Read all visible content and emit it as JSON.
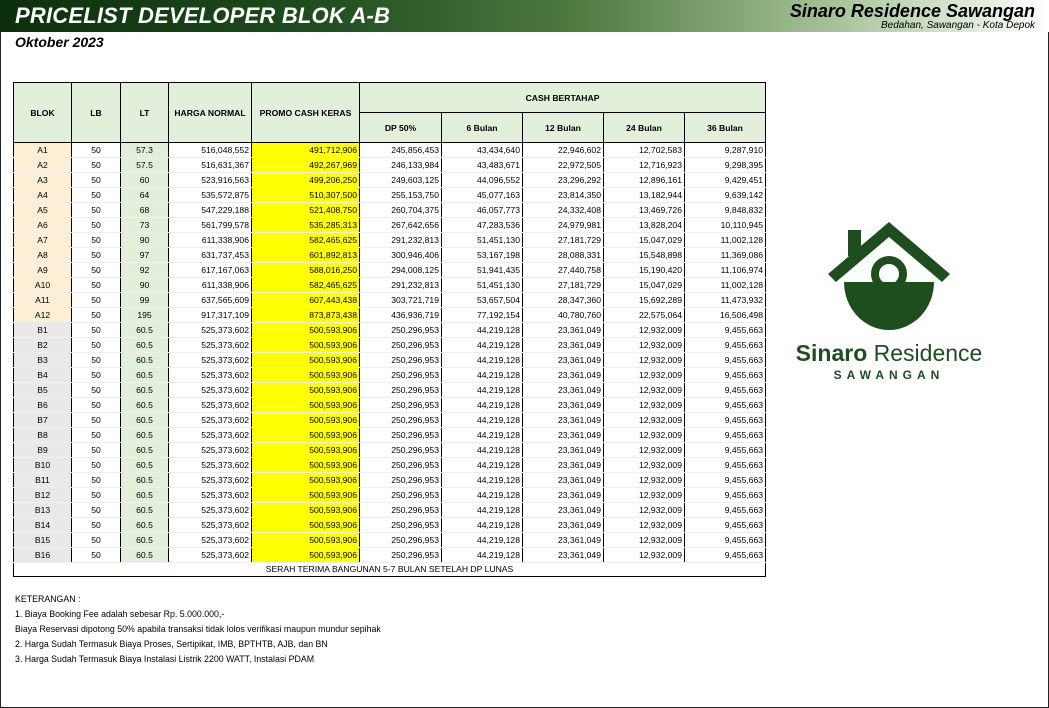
{
  "header": {
    "title": "PRICELIST DEVELOPER BLOK A-B",
    "period": "Oktober 2023",
    "brand": "Sinaro Residence Sawangan",
    "location": "Bedahan, Sawangan - Kota Depok"
  },
  "columns": {
    "blok": "BLOK",
    "lb": "LB",
    "lt": "LT",
    "harga_normal": "HARGA NORMAL",
    "promo": "PROMO CASH KERAS",
    "cash_bertahap": "CASH BERTAHAP",
    "dp": "DP 50%",
    "m6": "6 Bulan",
    "m12": "12 Bulan",
    "m24": "24 Bulan",
    "m36": "36 Bulan"
  },
  "rows": [
    [
      "A1",
      "50",
      "57.3",
      "516,048,552",
      "491,712,906",
      "245,856,453",
      "43,434,640",
      "22,946,602",
      "12,702,583",
      "9,287,910"
    ],
    [
      "A2",
      "50",
      "57.5",
      "516,631,367",
      "492,267,969",
      "246,133,984",
      "43,483,671",
      "22,972,505",
      "12,716,923",
      "9,298,395"
    ],
    [
      "A3",
      "50",
      "60",
      "523,916,563",
      "499,206,250",
      "249,603,125",
      "44,096,552",
      "23,296,292",
      "12,896,161",
      "9,429,451"
    ],
    [
      "A4",
      "50",
      "64",
      "535,572,875",
      "510,307,500",
      "255,153,750",
      "45,077,163",
      "23,814,350",
      "13,182,944",
      "9,639,142"
    ],
    [
      "A5",
      "50",
      "68",
      "547,229,188",
      "521,408,750",
      "260,704,375",
      "46,057,773",
      "24,332,408",
      "13,469,726",
      "9,848,832"
    ],
    [
      "A6",
      "50",
      "73",
      "561,799,578",
      "535,285,313",
      "267,642,656",
      "47,283,536",
      "24,979,981",
      "13,828,204",
      "10,110,945"
    ],
    [
      "A7",
      "50",
      "90",
      "611,338,906",
      "582,465,625",
      "291,232,813",
      "51,451,130",
      "27,181,729",
      "15,047,029",
      "11,002,128"
    ],
    [
      "A8",
      "50",
      "97",
      "631,737,453",
      "601,892,813",
      "300,946,406",
      "53,167,198",
      "28,088,331",
      "15,548,898",
      "11,369,086"
    ],
    [
      "A9",
      "50",
      "92",
      "617,167,063",
      "588,016,250",
      "294,008,125",
      "51,941,435",
      "27,440,758",
      "15,190,420",
      "11,106,974"
    ],
    [
      "A10",
      "50",
      "90",
      "611,338,906",
      "582,465,625",
      "291,232,813",
      "51,451,130",
      "27,181,729",
      "15,047,029",
      "11,002,128"
    ],
    [
      "A11",
      "50",
      "99",
      "637,565,609",
      "607,443,438",
      "303,721,719",
      "53,657,504",
      "28,347,360",
      "15,692,289",
      "11,473,932"
    ],
    [
      "A12",
      "50",
      "195",
      "917,317,109",
      "873,873,438",
      "436,936,719",
      "77,192,154",
      "40,780,760",
      "22,575,064",
      "16,506,498"
    ],
    [
      "B1",
      "50",
      "60.5",
      "525,373,602",
      "500,593,906",
      "250,296,953",
      "44,219,128",
      "23,361,049",
      "12,932,009",
      "9,455,663"
    ],
    [
      "B2",
      "50",
      "60.5",
      "525,373,602",
      "500,593,906",
      "250,296,953",
      "44,219,128",
      "23,361,049",
      "12,932,009",
      "9,455,663"
    ],
    [
      "B3",
      "50",
      "60.5",
      "525,373,602",
      "500,593,906",
      "250,296,953",
      "44,219,128",
      "23,361,049",
      "12,932,009",
      "9,455,663"
    ],
    [
      "B4",
      "50",
      "60.5",
      "525,373,602",
      "500,593,906",
      "250,296,953",
      "44,219,128",
      "23,361,049",
      "12,932,009",
      "9,455,663"
    ],
    [
      "B5",
      "50",
      "60.5",
      "525,373,602",
      "500,593,906",
      "250,296,953",
      "44,219,128",
      "23,361,049",
      "12,932,009",
      "9,455,663"
    ],
    [
      "B6",
      "50",
      "60.5",
      "525,373,602",
      "500,593,906",
      "250,296,953",
      "44,219,128",
      "23,361,049",
      "12,932,009",
      "9,455,663"
    ],
    [
      "B7",
      "50",
      "60.5",
      "525,373,602",
      "500,593,906",
      "250,296,953",
      "44,219,128",
      "23,361,049",
      "12,932,009",
      "9,455,663"
    ],
    [
      "B8",
      "50",
      "60.5",
      "525,373,602",
      "500,593,906",
      "250,296,953",
      "44,219,128",
      "23,361,049",
      "12,932,009",
      "9,455,663"
    ],
    [
      "B9",
      "50",
      "60.5",
      "525,373,602",
      "500,593,906",
      "250,296,953",
      "44,219,128",
      "23,361,049",
      "12,932,009",
      "9,455,663"
    ],
    [
      "B10",
      "50",
      "60.5",
      "525,373,602",
      "500,593,906",
      "250,296,953",
      "44,219,128",
      "23,361,049",
      "12,932,009",
      "9,455,663"
    ],
    [
      "B11",
      "50",
      "60.5",
      "525,373,602",
      "500,593,906",
      "250,296,953",
      "44,219,128",
      "23,361,049",
      "12,932,009",
      "9,455,663"
    ],
    [
      "B12",
      "50",
      "60.5",
      "525,373,602",
      "500,593,906",
      "250,296,953",
      "44,219,128",
      "23,361,049",
      "12,932,009",
      "9,455,663"
    ],
    [
      "B13",
      "50",
      "60.5",
      "525,373,602",
      "500,593,906",
      "250,296,953",
      "44,219,128",
      "23,361,049",
      "12,932,009",
      "9,455,663"
    ],
    [
      "B14",
      "50",
      "60.5",
      "525,373,602",
      "500,593,906",
      "250,296,953",
      "44,219,128",
      "23,361,049",
      "12,932,009",
      "9,455,663"
    ],
    [
      "B15",
      "50",
      "60.5",
      "525,373,602",
      "500,593,906",
      "250,296,953",
      "44,219,128",
      "23,361,049",
      "12,932,009",
      "9,455,663"
    ],
    [
      "B16",
      "50",
      "60.5",
      "525,373,602",
      "500,593,906",
      "250,296,953",
      "44,219,128",
      "23,361,049",
      "12,932,009",
      "9,455,663"
    ]
  ],
  "footer_note": "SERAH TERIMA BANGUNAN 5-7 BULAN SETELAH DP LUNAS",
  "notes": {
    "heading": "KETERANGAN :",
    "items": [
      "1. Biaya Booking Fee adalah sebesar Rp. 5.000.000,-",
      "Biaya Reservasi dipotong 50% apabila transaksi tidak lolos verifikasi maupun mundur sepihak",
      "2. Harga Sudah Termasuk Biaya Proses, Sertipikat, IMB, BPTHTB, AJB, dan BN",
      "3. Harga Sudah Termasuk Biaya Instalasi Listrik 2200 WATT, Instalasi PDAM"
    ]
  },
  "logo": {
    "name_bold": "Sinaro",
    "name_regular": "Residence",
    "tagline": "SAWANGAN",
    "icon": "house-logo-icon",
    "color": "#1e4d1e"
  },
  "colors": {
    "header_green": "#1e4d1e",
    "table_header": "#e2efda",
    "promo_highlight": "#ffff00",
    "blok_a": "#fcefd6",
    "blok_b": "#e9e9e9"
  }
}
